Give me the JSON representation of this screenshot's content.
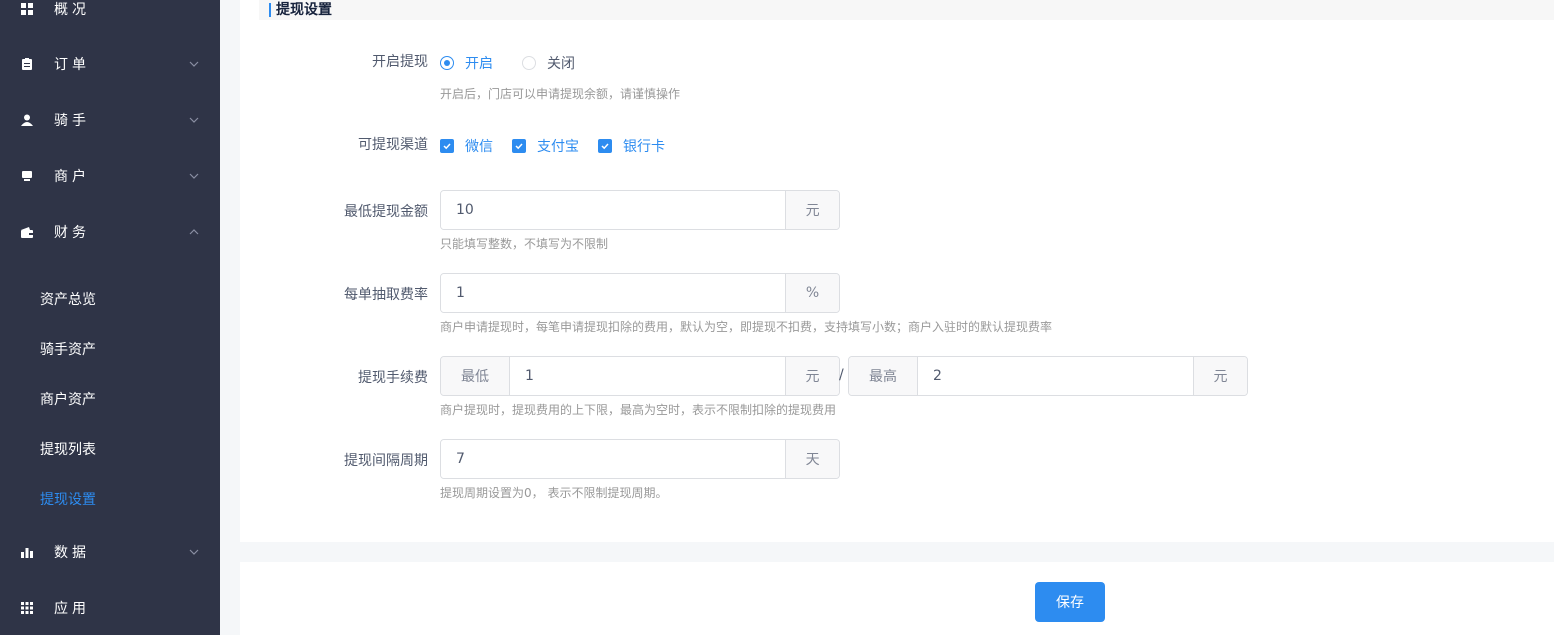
{
  "sidebar": {
    "items": [
      {
        "label": "概况",
        "icon": "grid-icon"
      },
      {
        "label": "订单",
        "icon": "clipboard-icon"
      },
      {
        "label": "骑手",
        "icon": "user-icon"
      },
      {
        "label": "商户",
        "icon": "shop-icon"
      },
      {
        "label": "财务",
        "icon": "wallet-icon"
      },
      {
        "label": "数据",
        "icon": "bar-chart-icon"
      },
      {
        "label": "应用",
        "icon": "apps-icon"
      }
    ],
    "finance_sub": [
      {
        "label": "资产总览"
      },
      {
        "label": "骑手资产"
      },
      {
        "label": "商户资产"
      },
      {
        "label": "提现列表"
      },
      {
        "label": "提现设置",
        "active": true
      }
    ]
  },
  "section": {
    "title": "提现设置"
  },
  "form": {
    "enable": {
      "label": "开启提现",
      "options": [
        "开启",
        "关闭"
      ],
      "selected": "开启",
      "hint": "开启后，门店可以申请提现余额，请谨慎操作"
    },
    "channels": {
      "label": "可提现渠道",
      "options": [
        "微信",
        "支付宝",
        "银行卡"
      ],
      "checked": [
        "微信",
        "支付宝",
        "银行卡"
      ]
    },
    "min_amount": {
      "label": "最低提现金额",
      "value": "10",
      "unit": "元",
      "hint": "只能填写整数，不填写为不限制"
    },
    "fee_rate": {
      "label": "每单抽取费率",
      "value": "1",
      "unit": "%",
      "hint": "商户申请提现时，每笔申请提现扣除的费用，默认为空，即提现不扣费，支持填写小数；商户入驻时的默认提现费率"
    },
    "fee_range": {
      "label": "提现手续费",
      "min_prefix": "最低",
      "min_value": "1",
      "min_unit": "元",
      "separator": "/",
      "max_prefix": "最高",
      "max_value": "2",
      "max_unit": "元",
      "hint": "商户提现时，提现费用的上下限，最高为空时，表示不限制扣除的提现费用"
    },
    "interval": {
      "label": "提现间隔周期",
      "value": "7",
      "unit": "天",
      "hint": "提现周期设置为0， 表示不限制提现周期。"
    }
  },
  "actions": {
    "save_label": "保存"
  },
  "colors": {
    "sidebar_bg": "#2f3447",
    "accent": "#2d8cf0"
  }
}
